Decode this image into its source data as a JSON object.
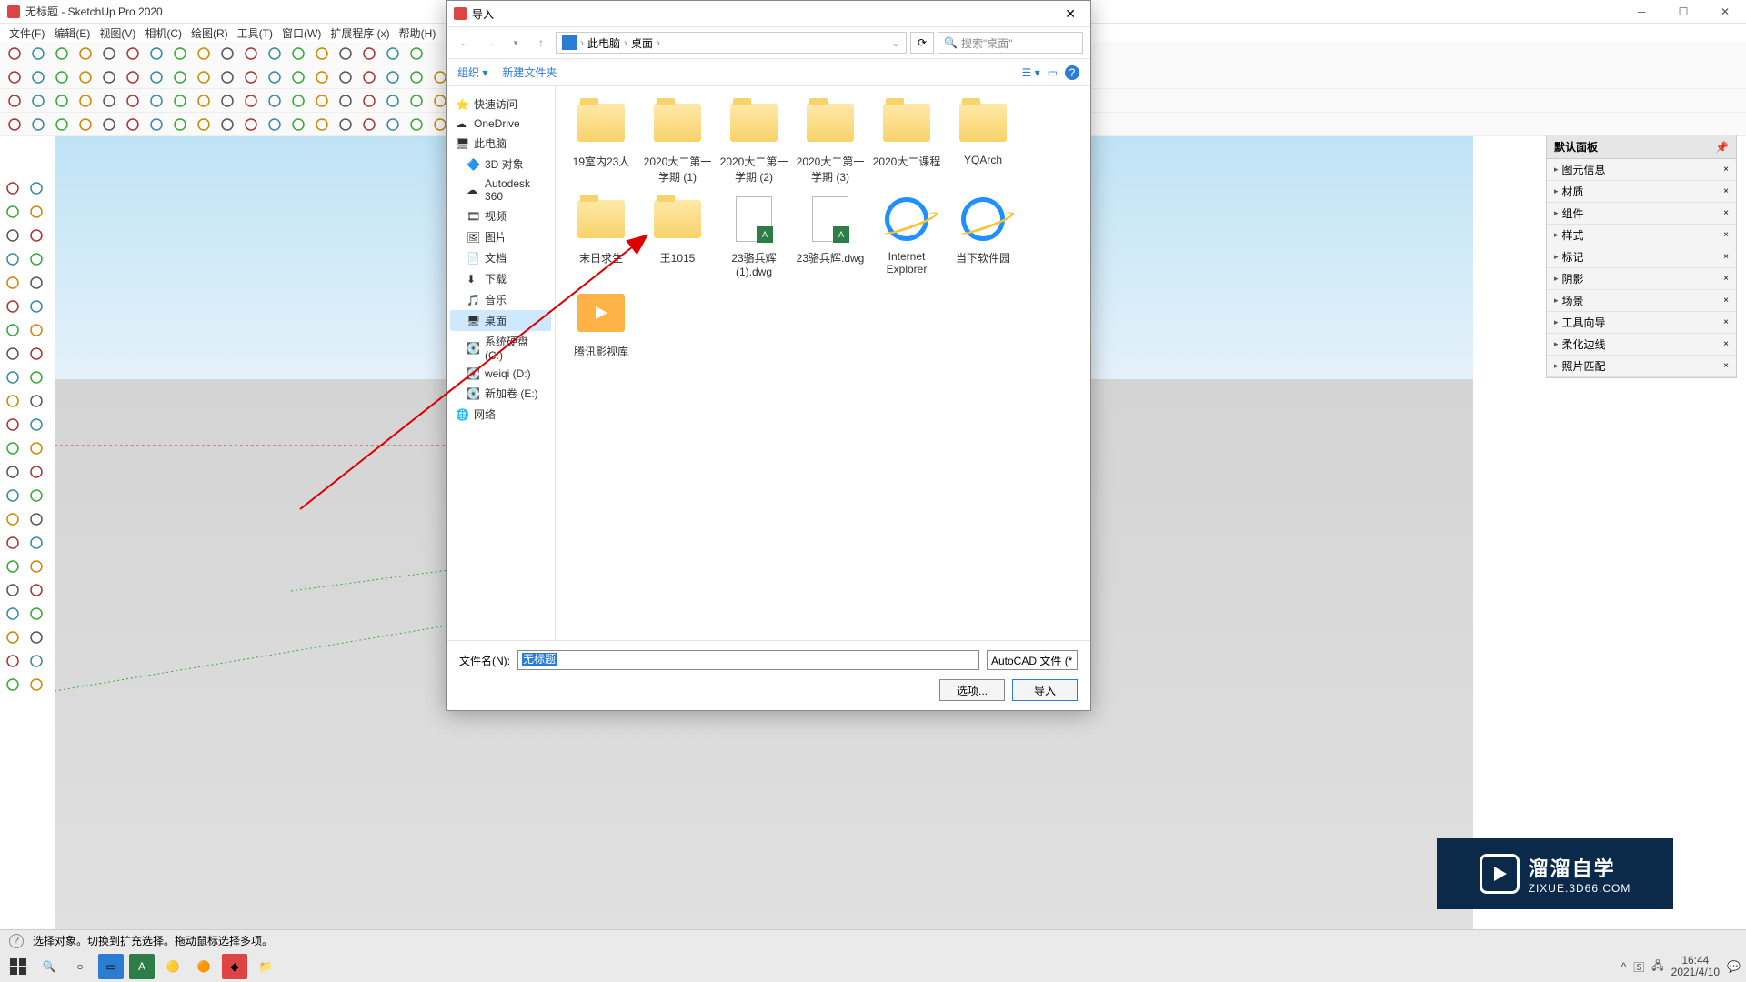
{
  "window": {
    "title": "无标题 - SketchUp Pro 2020"
  },
  "menubar": [
    "文件(F)",
    "编辑(E)",
    "视图(V)",
    "相机(C)",
    "绘图(R)",
    "工具(T)",
    "窗口(W)",
    "扩展程序 (x)",
    "帮助(H)"
  ],
  "tray": {
    "header": "默认面板",
    "items": [
      "图元信息",
      "材质",
      "组件",
      "样式",
      "标记",
      "阴影",
      "场景",
      "工具向导",
      "柔化边线",
      "照片匹配"
    ]
  },
  "status": {
    "text": "选择对象。切换到扩充选择。拖动鼠标选择多项。"
  },
  "dialog": {
    "title": "导入",
    "breadcrumb": {
      "root": "此电脑",
      "folder": "桌面"
    },
    "searchPlaceholder": "搜索\"桌面\"",
    "toolbar": {
      "organize": "组织",
      "newFolder": "新建文件夹"
    },
    "tree": [
      {
        "label": "快速访问",
        "icon": "star",
        "indent": 0
      },
      {
        "label": "OneDrive",
        "icon": "cloud",
        "indent": 0
      },
      {
        "label": "此电脑",
        "icon": "pc",
        "indent": 0
      },
      {
        "label": "3D 对象",
        "icon": "3d",
        "indent": 1
      },
      {
        "label": "Autodesk 360",
        "icon": "cloud",
        "indent": 1
      },
      {
        "label": "视频",
        "icon": "video",
        "indent": 1
      },
      {
        "label": "图片",
        "icon": "pic",
        "indent": 1
      },
      {
        "label": "文档",
        "icon": "doc",
        "indent": 1
      },
      {
        "label": "下载",
        "icon": "dl",
        "indent": 1
      },
      {
        "label": "音乐",
        "icon": "music",
        "indent": 1
      },
      {
        "label": "桌面",
        "icon": "desktop",
        "indent": 1,
        "sel": true
      },
      {
        "label": "系统硬盘 (C:)",
        "icon": "drive",
        "indent": 1
      },
      {
        "label": "weiqi (D:)",
        "icon": "drive",
        "indent": 1
      },
      {
        "label": "新加卷 (E:)",
        "icon": "drive",
        "indent": 1
      },
      {
        "label": "网络",
        "icon": "net",
        "indent": 0
      }
    ],
    "files": [
      {
        "name": "19室内23人",
        "type": "folder-img"
      },
      {
        "name": "2020大二第一学期 (1)",
        "type": "folder-img"
      },
      {
        "name": "2020大二第一学期 (2)",
        "type": "folder-img"
      },
      {
        "name": "2020大二第一学期 (3)",
        "type": "folder-img"
      },
      {
        "name": "2020大二课程",
        "type": "folder"
      },
      {
        "name": "YQArch",
        "type": "folder"
      },
      {
        "name": "末日求生",
        "type": "folder-img"
      },
      {
        "name": "王1015",
        "type": "folder-img"
      },
      {
        "name": "23骆兵辉 (1).dwg",
        "type": "dwg"
      },
      {
        "name": "23骆兵辉.dwg",
        "type": "dwg"
      },
      {
        "name": "Internet Explorer",
        "type": "ie"
      },
      {
        "name": "当下软件园",
        "type": "ie"
      },
      {
        "name": "腾讯影视库",
        "type": "video"
      }
    ],
    "fileNameLabel": "文件名(N):",
    "fileNameValue": "无标题",
    "fileTypeValue": "AutoCAD 文件 (*",
    "buttons": {
      "options": "选项...",
      "import": "导入"
    }
  },
  "taskbar": {
    "time": "16:44",
    "date": "2021/4/10"
  },
  "watermark": {
    "ch": "溜溜自学",
    "en": "ZIXUE.3D66.COM"
  }
}
